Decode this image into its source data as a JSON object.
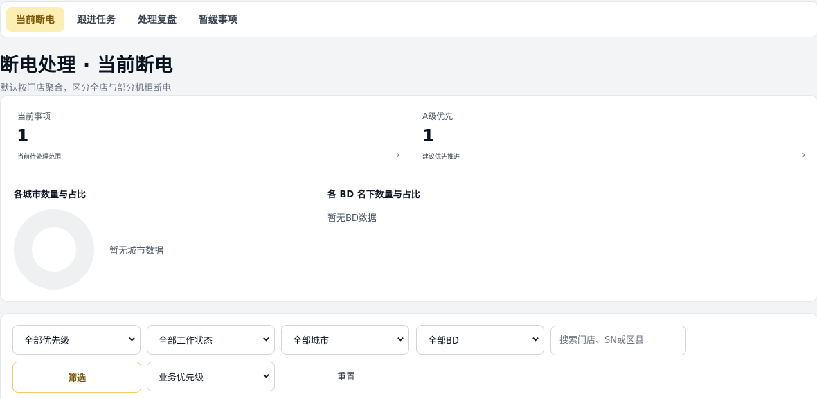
{
  "tabs": [
    "当前断电",
    "跟进任务",
    "处理复盘",
    "暂缓事项"
  ],
  "page": {
    "title": "断电处理 · 当前断电",
    "subtitle": "默认按门店聚合，区分全店与部分机柜断电"
  },
  "stats": [
    {
      "label": "当前事项",
      "value": "1",
      "note": "当前待处理范围",
      "chevron": "›"
    },
    {
      "label": "A级优先",
      "value": "1",
      "note": "建议优先推进",
      "chevron": "›"
    }
  ],
  "city_section": {
    "title": "各城市数量与占比",
    "empty": "暂无城市数据"
  },
  "bd_section": {
    "title": "各 BD 名下数量与占比",
    "empty": "暂无BD数据"
  },
  "filters": {
    "priority": "全部优先级",
    "work_status": "全部工作状态",
    "city": "全部城市",
    "bd": "全部BD",
    "search_placeholder": "搜索门店、SN或区县",
    "filter_button": "筛选",
    "business_priority": "业务优先级",
    "reset_button": "重置"
  },
  "colors": {
    "accent": "#fdeeb4",
    "accent_text": "#7a5a0a",
    "accent_border": "#f3c96a"
  },
  "icons": {
    "chevron": "chevron-right-icon",
    "caret": "chevron-down-icon",
    "donut": "donut-chart-placeholder"
  }
}
